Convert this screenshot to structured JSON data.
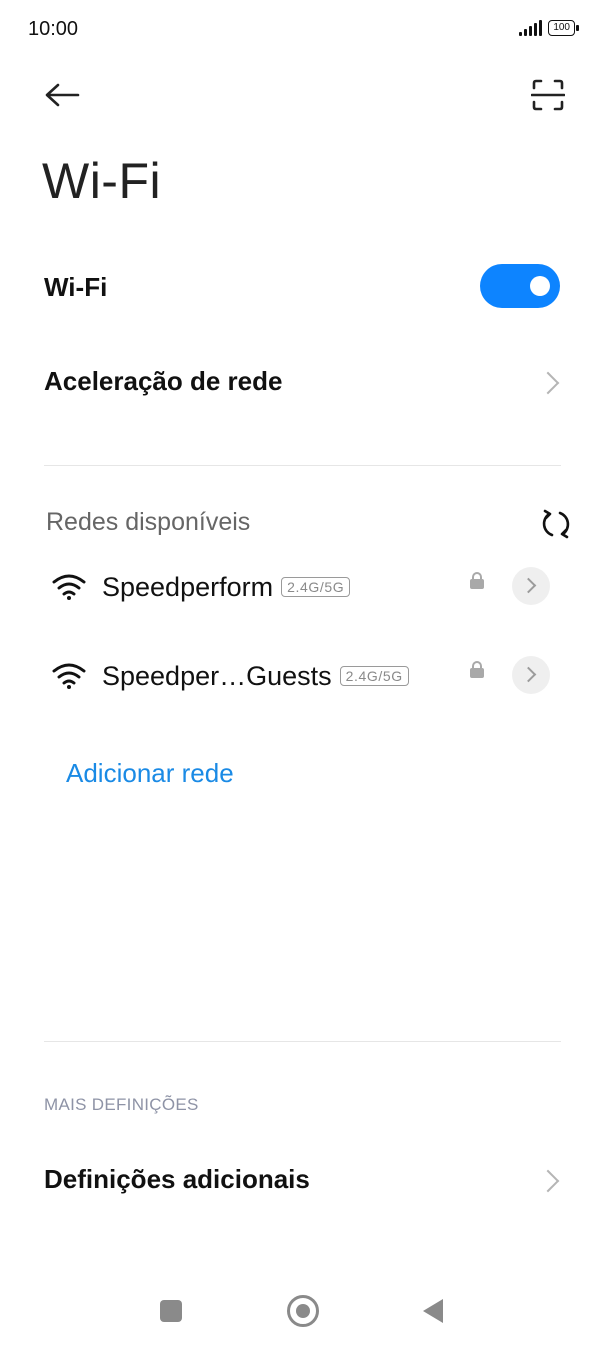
{
  "status_bar": {
    "time": "10:00",
    "battery": "100"
  },
  "header": {
    "back_icon": "arrow-left-icon",
    "scan_icon": "scan-icon"
  },
  "page": {
    "title": "Wi-Fi"
  },
  "wifi_toggle": {
    "label": "Wi-Fi",
    "state": "on",
    "accent_color": "#0d84ff"
  },
  "network_acceleration": {
    "label": "Aceleração de rede"
  },
  "available_networks": {
    "title": "Redes disponíveis",
    "refresh_icon": "refresh-icon",
    "items": [
      {
        "name": "Speedperform",
        "band": "2.4G/5G",
        "secured": true
      },
      {
        "name": "Speedper…Guests",
        "band": "2.4G/5G",
        "secured": true
      }
    ]
  },
  "add_network": {
    "label": "Adicionar rede",
    "color": "#1a8ae5"
  },
  "more_settings": {
    "section_label": "MAIS DEFINIÇÕES",
    "additional_settings_label": "Definições adicionais"
  },
  "navbar": {
    "recents_icon": "square-icon",
    "home_icon": "home-circle-icon",
    "back_icon": "triangle-back-icon"
  }
}
